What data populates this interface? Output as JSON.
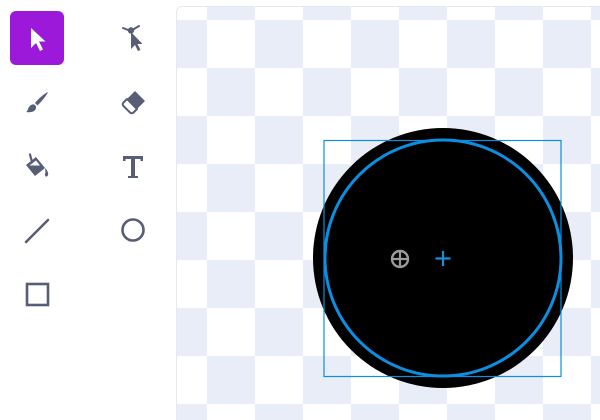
{
  "toolbar": {
    "tools": [
      {
        "name": "select",
        "icon": "arrow-pointer-icon",
        "active": true
      },
      {
        "name": "reshape",
        "icon": "reshape-icon",
        "active": false
      },
      {
        "name": "brush",
        "icon": "brush-icon",
        "active": false
      },
      {
        "name": "eraser",
        "icon": "eraser-icon",
        "active": false
      },
      {
        "name": "fill",
        "icon": "fill-bucket-icon",
        "active": false
      },
      {
        "name": "text",
        "icon": "text-t-icon",
        "active": false
      },
      {
        "name": "line",
        "icon": "line-icon",
        "active": false
      },
      {
        "name": "circle",
        "icon": "circle-icon",
        "active": false
      },
      {
        "name": "rectangle",
        "icon": "rectangle-icon",
        "active": false
      }
    ]
  },
  "colors": {
    "active_tool_bg": "#9d19d9",
    "icon": "#575e75",
    "canvas_checker": "#e8edf7",
    "shape_fill": "#000000",
    "selection": "#0b8fe0",
    "center_handle": "#9a9a9a"
  },
  "canvas": {
    "shape": "circle",
    "selected": true
  }
}
